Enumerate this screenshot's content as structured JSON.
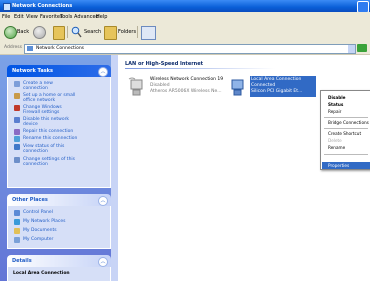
{
  "window": {
    "title": "Network Connections"
  },
  "menubar": [
    "File",
    "Edit",
    "View",
    "Favorites",
    "Tools",
    "Advanced",
    "Help"
  ],
  "toolbar": {
    "back": "Back",
    "search": "Search",
    "folders": "Folders"
  },
  "address": {
    "label": "Address",
    "value": "Network Connections",
    "go": "Go"
  },
  "tasks_panel": {
    "title": "Network Tasks",
    "items": [
      [
        "Create a new",
        "connection"
      ],
      [
        "Set up a home or small",
        "office network"
      ],
      [
        "Change Windows",
        "Firewall settings"
      ],
      [
        "Disable this network",
        "device"
      ],
      [
        "Repair this connection"
      ],
      [
        "Rename this connection"
      ],
      [
        "View status of this",
        "connection"
      ],
      [
        "Change settings of this",
        "connection"
      ]
    ]
  },
  "other_places": {
    "title": "Other Places",
    "items": [
      "Control Panel",
      "My Network Places",
      "My Documents",
      "My Computer"
    ]
  },
  "details": {
    "title": "Details",
    "line": "Local Area Connection"
  },
  "main": {
    "group_header": "LAN or High-Speed Internet",
    "connections": [
      {
        "name": "Wireless Network Connection 19",
        "status": "Disabled",
        "device": "Atheros AR5006X Wireless Ne..."
      },
      {
        "name": "Local Area Connection",
        "status": "Connected",
        "device": "Silicon PCI Gigabit Et..."
      }
    ]
  },
  "context_menu": {
    "items": [
      "Disable",
      "Status",
      "Repair",
      "Bridge Connections",
      "Create Shortcut",
      "Delete",
      "Rename",
      "Properties"
    ],
    "selected": "Properties",
    "disabled": [
      "Delete"
    ]
  },
  "colors": {
    "accent": "#316ac5",
    "pane": "#6f8fe0",
    "titlebar": "#0a5fd8"
  }
}
